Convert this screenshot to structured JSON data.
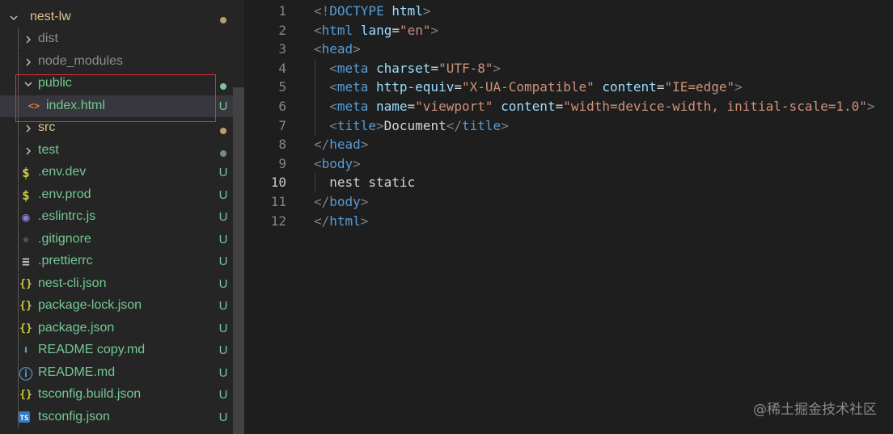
{
  "explorer": {
    "items": [
      {
        "label": "nest-lw",
        "kind": "folder-open",
        "color": "#e2c08d",
        "status": "dot",
        "status_color": "#b8a067"
      },
      {
        "label": "dist",
        "kind": "folder",
        "color": "#8c8c8c",
        "status": "",
        "status_color": ""
      },
      {
        "label": "node_modules",
        "kind": "folder",
        "color": "#8c8c8c",
        "status": "",
        "status_color": ""
      },
      {
        "label": "public",
        "kind": "folder-open",
        "color": "#73c991",
        "status": "dot",
        "status_color": "#73c991"
      },
      {
        "label": "index.html",
        "kind": "html",
        "color": "#73c991",
        "status": "U",
        "status_color": "#73c991"
      },
      {
        "label": "src",
        "kind": "folder",
        "color": "#e2c08d",
        "status": "dot",
        "status_color": "#b8a067"
      },
      {
        "label": "test",
        "kind": "folder",
        "color": "#73c991",
        "status": "dot",
        "status_color": "#6f8f7a"
      },
      {
        "label": ".env.dev",
        "kind": "env",
        "color": "#73c991",
        "status": "U",
        "status_color": "#73c991"
      },
      {
        "label": ".env.prod",
        "kind": "env",
        "color": "#73c991",
        "status": "U",
        "status_color": "#73c991"
      },
      {
        "label": ".eslintrc.js",
        "kind": "eslint",
        "color": "#73c991",
        "status": "U",
        "status_color": "#73c991"
      },
      {
        "label": ".gitignore",
        "kind": "git",
        "color": "#73c991",
        "status": "U",
        "status_color": "#73c991"
      },
      {
        "label": ".prettierrc",
        "kind": "lines",
        "color": "#73c991",
        "status": "U",
        "status_color": "#73c991"
      },
      {
        "label": "nest-cli.json",
        "kind": "json",
        "color": "#73c991",
        "status": "U",
        "status_color": "#73c991"
      },
      {
        "label": "package-lock.json",
        "kind": "json",
        "color": "#73c991",
        "status": "U",
        "status_color": "#73c991"
      },
      {
        "label": "package.json",
        "kind": "json",
        "color": "#73c991",
        "status": "U",
        "status_color": "#73c991"
      },
      {
        "label": "README copy.md",
        "kind": "md-down",
        "color": "#73c991",
        "status": "U",
        "status_color": "#73c991"
      },
      {
        "label": "README.md",
        "kind": "info",
        "color": "#73c991",
        "status": "U",
        "status_color": "#73c991"
      },
      {
        "label": "tsconfig.build.json",
        "kind": "json",
        "color": "#73c991",
        "status": "U",
        "status_color": "#73c991"
      },
      {
        "label": "tsconfig.json",
        "kind": "ts",
        "color": "#73c991",
        "status": "U",
        "status_color": "#73c991"
      }
    ]
  },
  "editor": {
    "active_line": 10,
    "lines": [
      {
        "n": "1",
        "indent": 0,
        "tokens": [
          [
            "b",
            "<!"
          ],
          [
            "tag",
            "DOCTYPE"
          ],
          [
            "t",
            " "
          ],
          [
            "attr",
            "html"
          ],
          [
            "b",
            ">"
          ]
        ]
      },
      {
        "n": "2",
        "indent": 0,
        "tokens": [
          [
            "b",
            "<"
          ],
          [
            "tag",
            "html"
          ],
          [
            "t",
            " "
          ],
          [
            "attr",
            "lang"
          ],
          [
            "t",
            "="
          ],
          [
            "str",
            "\"en\""
          ],
          [
            "b",
            ">"
          ]
        ]
      },
      {
        "n": "3",
        "indent": 0,
        "tokens": [
          [
            "b",
            "<"
          ],
          [
            "tag",
            "head"
          ],
          [
            "b",
            ">"
          ]
        ]
      },
      {
        "n": "4",
        "indent": 1,
        "tokens": [
          [
            "b",
            "<"
          ],
          [
            "tag",
            "meta"
          ],
          [
            "t",
            " "
          ],
          [
            "attr",
            "charset"
          ],
          [
            "t",
            "="
          ],
          [
            "str",
            "\"UTF-8\""
          ],
          [
            "b",
            ">"
          ]
        ]
      },
      {
        "n": "5",
        "indent": 1,
        "tokens": [
          [
            "b",
            "<"
          ],
          [
            "tag",
            "meta"
          ],
          [
            "t",
            " "
          ],
          [
            "attr",
            "http-equiv"
          ],
          [
            "t",
            "="
          ],
          [
            "str",
            "\"X-UA-Compatible\""
          ],
          [
            "t",
            " "
          ],
          [
            "attr",
            "content"
          ],
          [
            "t",
            "="
          ],
          [
            "str",
            "\"IE=edge\""
          ],
          [
            "b",
            ">"
          ]
        ]
      },
      {
        "n": "6",
        "indent": 1,
        "tokens": [
          [
            "b",
            "<"
          ],
          [
            "tag",
            "meta"
          ],
          [
            "t",
            " "
          ],
          [
            "attr",
            "name"
          ],
          [
            "t",
            "="
          ],
          [
            "str",
            "\"viewport\""
          ],
          [
            "t",
            " "
          ],
          [
            "attr",
            "content"
          ],
          [
            "t",
            "="
          ],
          [
            "str",
            "\"width=device-width, initial-scale=1.0\""
          ],
          [
            "b",
            ">"
          ]
        ]
      },
      {
        "n": "7",
        "indent": 1,
        "tokens": [
          [
            "b",
            "<"
          ],
          [
            "tag",
            "title"
          ],
          [
            "b",
            ">"
          ],
          [
            "t",
            "Document"
          ],
          [
            "b",
            "</"
          ],
          [
            "tag",
            "title"
          ],
          [
            "b",
            ">"
          ]
        ]
      },
      {
        "n": "8",
        "indent": 0,
        "tokens": [
          [
            "b",
            "</"
          ],
          [
            "tag",
            "head"
          ],
          [
            "b",
            ">"
          ]
        ]
      },
      {
        "n": "9",
        "indent": 0,
        "tokens": [
          [
            "b",
            "<"
          ],
          [
            "tag",
            "body"
          ],
          [
            "b",
            ">"
          ]
        ]
      },
      {
        "n": "10",
        "indent": 1,
        "tokens": [
          [
            "t",
            "nest static"
          ]
        ]
      },
      {
        "n": "11",
        "indent": 0,
        "tokens": [
          [
            "b",
            "</"
          ],
          [
            "tag",
            "body"
          ],
          [
            "b",
            ">"
          ]
        ]
      },
      {
        "n": "12",
        "indent": 0,
        "tokens": [
          [
            "b",
            "</"
          ],
          [
            "tag",
            "html"
          ],
          [
            "b",
            ">"
          ]
        ]
      }
    ]
  },
  "watermark": "@稀土掘金技术社区"
}
